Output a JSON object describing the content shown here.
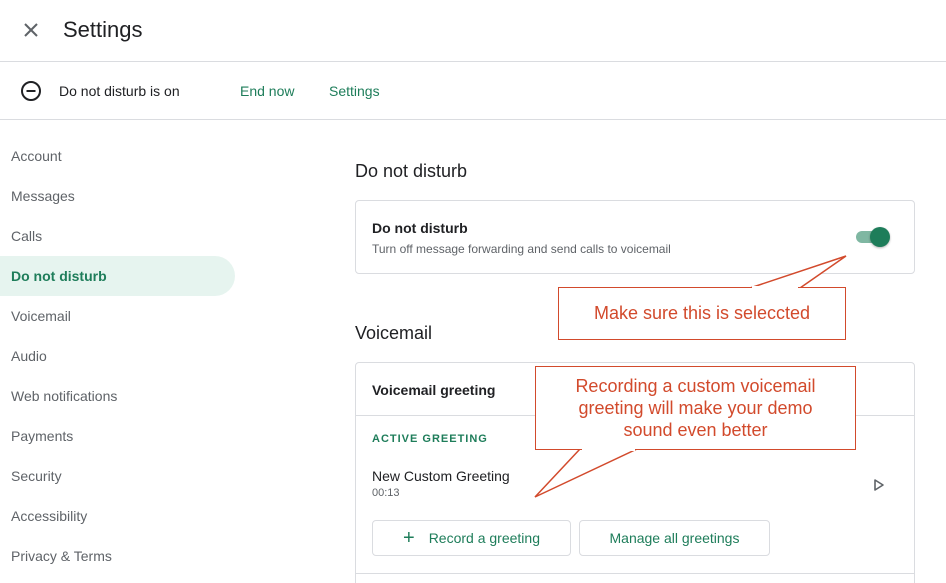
{
  "header": {
    "title": "Settings",
    "close_icon": "close-icon"
  },
  "banner": {
    "status": "Do not disturb is on",
    "end_now": "End now",
    "settings": "Settings",
    "icon": "do-not-disturb-icon"
  },
  "sidebar": {
    "items": [
      {
        "label": "Account"
      },
      {
        "label": "Messages"
      },
      {
        "label": "Calls"
      },
      {
        "label": "Do not disturb",
        "active": true
      },
      {
        "label": "Voicemail"
      },
      {
        "label": "Audio"
      },
      {
        "label": "Web notifications"
      },
      {
        "label": "Payments"
      },
      {
        "label": "Security"
      },
      {
        "label": "Accessibility"
      },
      {
        "label": "Privacy & Terms"
      }
    ]
  },
  "dnd": {
    "section_title": "Do not disturb",
    "card_title": "Do not disturb",
    "card_subtitle": "Turn off message forwarding and send calls to voicemail",
    "toggle_on": true
  },
  "voicemail": {
    "section_title": "Voicemail",
    "card_title": "Voicemail greeting",
    "active_label": "ACTIVE GREETING",
    "greeting_name": "New Custom Greeting",
    "greeting_duration": "00:13",
    "record_button": "Record a greeting",
    "manage_button": "Manage all greetings"
  },
  "annotations": {
    "callout_1": "Make sure this is seleccted",
    "callout_2_line1": "Recording a custom voicemail",
    "callout_2_line2": "greeting will make your demo",
    "callout_2_line3": "sound even better"
  },
  "colors": {
    "accent": "#1e7d5a",
    "callout": "#d24a2c",
    "active_bg": "#e6f4ef"
  }
}
